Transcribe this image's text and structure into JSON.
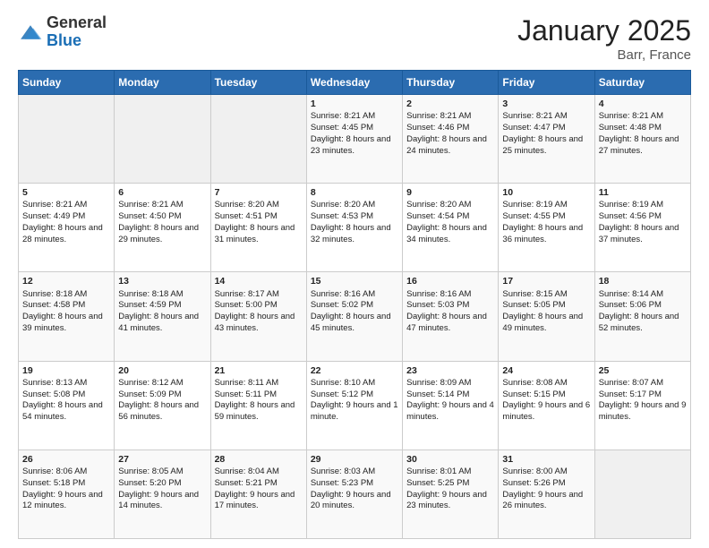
{
  "header": {
    "logo_general": "General",
    "logo_blue": "Blue",
    "month_title": "January 2025",
    "location": "Barr, France"
  },
  "days_of_week": [
    "Sunday",
    "Monday",
    "Tuesday",
    "Wednesday",
    "Thursday",
    "Friday",
    "Saturday"
  ],
  "weeks": [
    [
      {
        "day": "",
        "content": ""
      },
      {
        "day": "",
        "content": ""
      },
      {
        "day": "",
        "content": ""
      },
      {
        "day": "1",
        "content": "Sunrise: 8:21 AM\nSunset: 4:45 PM\nDaylight: 8 hours and 23 minutes."
      },
      {
        "day": "2",
        "content": "Sunrise: 8:21 AM\nSunset: 4:46 PM\nDaylight: 8 hours and 24 minutes."
      },
      {
        "day": "3",
        "content": "Sunrise: 8:21 AM\nSunset: 4:47 PM\nDaylight: 8 hours and 25 minutes."
      },
      {
        "day": "4",
        "content": "Sunrise: 8:21 AM\nSunset: 4:48 PM\nDaylight: 8 hours and 27 minutes."
      }
    ],
    [
      {
        "day": "5",
        "content": "Sunrise: 8:21 AM\nSunset: 4:49 PM\nDaylight: 8 hours and 28 minutes."
      },
      {
        "day": "6",
        "content": "Sunrise: 8:21 AM\nSunset: 4:50 PM\nDaylight: 8 hours and 29 minutes."
      },
      {
        "day": "7",
        "content": "Sunrise: 8:20 AM\nSunset: 4:51 PM\nDaylight: 8 hours and 31 minutes."
      },
      {
        "day": "8",
        "content": "Sunrise: 8:20 AM\nSunset: 4:53 PM\nDaylight: 8 hours and 32 minutes."
      },
      {
        "day": "9",
        "content": "Sunrise: 8:20 AM\nSunset: 4:54 PM\nDaylight: 8 hours and 34 minutes."
      },
      {
        "day": "10",
        "content": "Sunrise: 8:19 AM\nSunset: 4:55 PM\nDaylight: 8 hours and 36 minutes."
      },
      {
        "day": "11",
        "content": "Sunrise: 8:19 AM\nSunset: 4:56 PM\nDaylight: 8 hours and 37 minutes."
      }
    ],
    [
      {
        "day": "12",
        "content": "Sunrise: 8:18 AM\nSunset: 4:58 PM\nDaylight: 8 hours and 39 minutes."
      },
      {
        "day": "13",
        "content": "Sunrise: 8:18 AM\nSunset: 4:59 PM\nDaylight: 8 hours and 41 minutes."
      },
      {
        "day": "14",
        "content": "Sunrise: 8:17 AM\nSunset: 5:00 PM\nDaylight: 8 hours and 43 minutes."
      },
      {
        "day": "15",
        "content": "Sunrise: 8:16 AM\nSunset: 5:02 PM\nDaylight: 8 hours and 45 minutes."
      },
      {
        "day": "16",
        "content": "Sunrise: 8:16 AM\nSunset: 5:03 PM\nDaylight: 8 hours and 47 minutes."
      },
      {
        "day": "17",
        "content": "Sunrise: 8:15 AM\nSunset: 5:05 PM\nDaylight: 8 hours and 49 minutes."
      },
      {
        "day": "18",
        "content": "Sunrise: 8:14 AM\nSunset: 5:06 PM\nDaylight: 8 hours and 52 minutes."
      }
    ],
    [
      {
        "day": "19",
        "content": "Sunrise: 8:13 AM\nSunset: 5:08 PM\nDaylight: 8 hours and 54 minutes."
      },
      {
        "day": "20",
        "content": "Sunrise: 8:12 AM\nSunset: 5:09 PM\nDaylight: 8 hours and 56 minutes."
      },
      {
        "day": "21",
        "content": "Sunrise: 8:11 AM\nSunset: 5:11 PM\nDaylight: 8 hours and 59 minutes."
      },
      {
        "day": "22",
        "content": "Sunrise: 8:10 AM\nSunset: 5:12 PM\nDaylight: 9 hours and 1 minute."
      },
      {
        "day": "23",
        "content": "Sunrise: 8:09 AM\nSunset: 5:14 PM\nDaylight: 9 hours and 4 minutes."
      },
      {
        "day": "24",
        "content": "Sunrise: 8:08 AM\nSunset: 5:15 PM\nDaylight: 9 hours and 6 minutes."
      },
      {
        "day": "25",
        "content": "Sunrise: 8:07 AM\nSunset: 5:17 PM\nDaylight: 9 hours and 9 minutes."
      }
    ],
    [
      {
        "day": "26",
        "content": "Sunrise: 8:06 AM\nSunset: 5:18 PM\nDaylight: 9 hours and 12 minutes."
      },
      {
        "day": "27",
        "content": "Sunrise: 8:05 AM\nSunset: 5:20 PM\nDaylight: 9 hours and 14 minutes."
      },
      {
        "day": "28",
        "content": "Sunrise: 8:04 AM\nSunset: 5:21 PM\nDaylight: 9 hours and 17 minutes."
      },
      {
        "day": "29",
        "content": "Sunrise: 8:03 AM\nSunset: 5:23 PM\nDaylight: 9 hours and 20 minutes."
      },
      {
        "day": "30",
        "content": "Sunrise: 8:01 AM\nSunset: 5:25 PM\nDaylight: 9 hours and 23 minutes."
      },
      {
        "day": "31",
        "content": "Sunrise: 8:00 AM\nSunset: 5:26 PM\nDaylight: 9 hours and 26 minutes."
      },
      {
        "day": "",
        "content": ""
      }
    ]
  ]
}
